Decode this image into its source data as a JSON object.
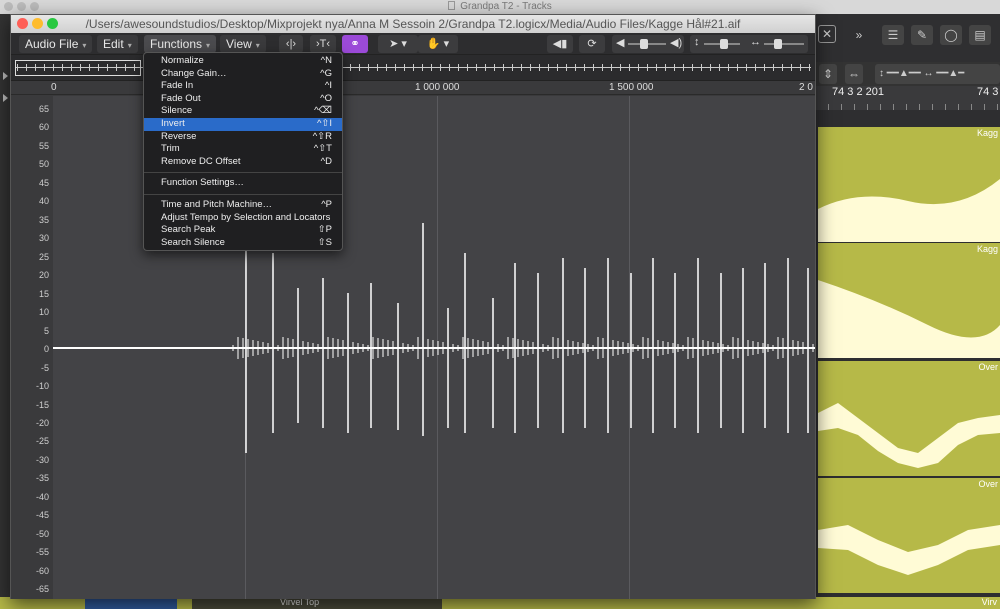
{
  "background": {
    "app_title": "Grandpa T2 - Tracks",
    "ruler_labels": [
      "74 3 2 201",
      "74 3"
    ],
    "regions": [
      {
        "name": "Kagg"
      },
      {
        "name": "Kagg"
      },
      {
        "name": "Over"
      },
      {
        "name": "Over"
      }
    ],
    "bottom_labels": [
      "Virvel Top",
      "Virv"
    ]
  },
  "window": {
    "title": "/Users/awesoundstudios/Desktop/Mixprojekt nya/Anna M Sessoin 2/Grandpa T2.logicx/Media/Audio Files/Kagge Hål#21.aif"
  },
  "toolbar": {
    "menus": [
      {
        "label": "Audio File"
      },
      {
        "label": "Edit"
      },
      {
        "label": "Functions"
      },
      {
        "label": "View"
      }
    ]
  },
  "ruler": {
    "labels": [
      "0",
      "1 000 000",
      "1 500 000",
      "2 0"
    ]
  },
  "yaxis": {
    "labels": [
      "65",
      "60",
      "55",
      "50",
      "45",
      "40",
      "35",
      "30",
      "25",
      "20",
      "15",
      "10",
      "5",
      "0",
      "-5",
      "-10",
      "-15",
      "-20",
      "-25",
      "-30",
      "-35",
      "-40",
      "-45",
      "-50",
      "-55",
      "-60",
      "-65"
    ]
  },
  "functions_menu": {
    "group1": [
      {
        "label": "Normalize",
        "shortcut": "^N"
      },
      {
        "label": "Change Gain…",
        "shortcut": "^G"
      },
      {
        "label": "Fade In",
        "shortcut": "^I"
      },
      {
        "label": "Fade Out",
        "shortcut": "^O"
      },
      {
        "label": "Silence",
        "shortcut": "^⌫"
      },
      {
        "label": "Invert",
        "shortcut": "^⇧I",
        "highlighted": true
      },
      {
        "label": "Reverse",
        "shortcut": "^⇧R"
      },
      {
        "label": "Trim",
        "shortcut": "^⇧T"
      },
      {
        "label": "Remove DC Offset",
        "shortcut": "^D"
      }
    ],
    "group2": [
      {
        "label": "Function Settings…",
        "shortcut": ""
      }
    ],
    "group3": [
      {
        "label": "Time and Pitch Machine…",
        "shortcut": "^P"
      },
      {
        "label": "Adjust Tempo by Selection and Locators",
        "shortcut": ""
      },
      {
        "label": "Search Peak",
        "shortcut": "⇧P"
      },
      {
        "label": "Search Silence",
        "shortcut": "⇧S"
      }
    ]
  },
  "colors": {
    "region": "#b6b948",
    "waveform": "#ffffff",
    "highlight": "#2a6bc9",
    "link_button": "#9b4ad8"
  }
}
